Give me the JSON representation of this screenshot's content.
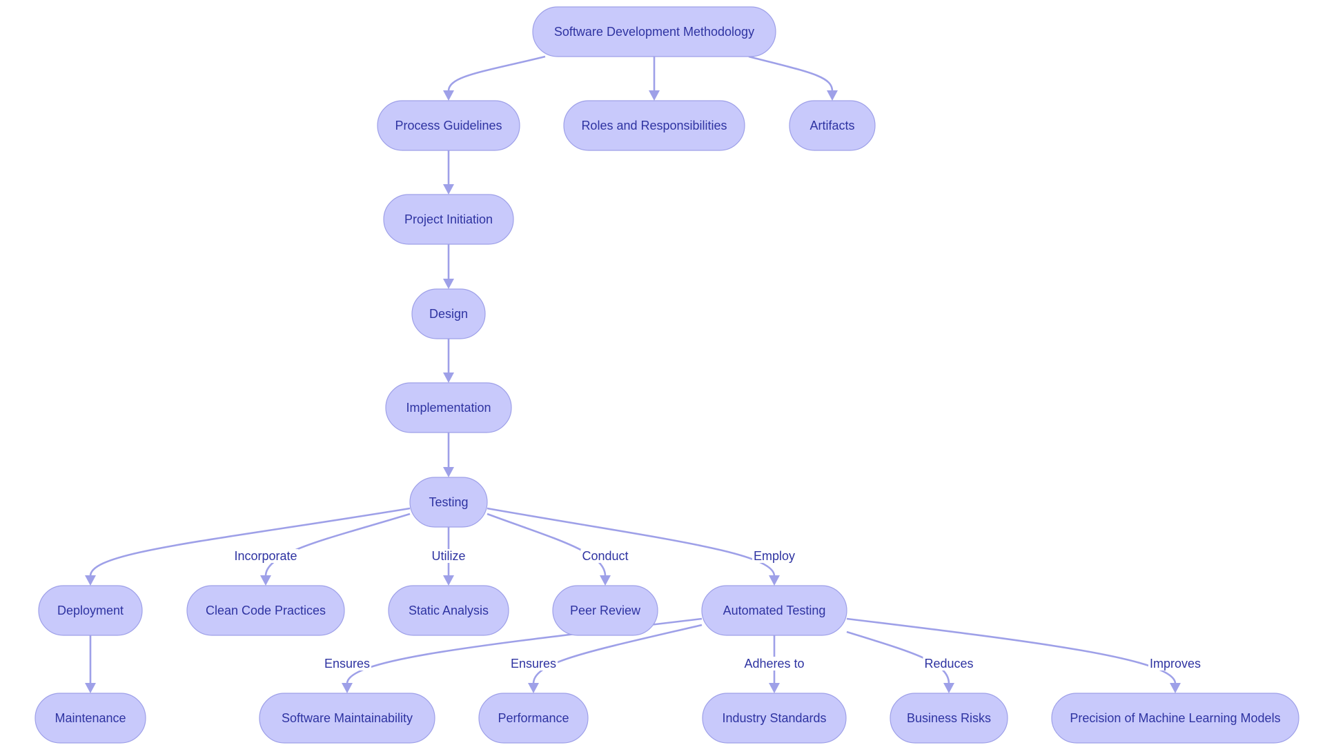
{
  "diagram": {
    "type": "flowchart",
    "title": "Software Development Methodology",
    "colors": {
      "node_fill": "#c8c9fb",
      "node_stroke": "#9ea0e8",
      "edge": "#9ea0e8",
      "text": "#2e33a1"
    },
    "nodes": [
      {
        "id": "sdm",
        "label": "Software Development Methodology"
      },
      {
        "id": "pg",
        "label": "Process Guidelines"
      },
      {
        "id": "rr",
        "label": "Roles and Responsibilities"
      },
      {
        "id": "art",
        "label": "Artifacts"
      },
      {
        "id": "pi",
        "label": "Project Initiation"
      },
      {
        "id": "des",
        "label": "Design"
      },
      {
        "id": "imp",
        "label": "Implementation"
      },
      {
        "id": "tst",
        "label": "Testing"
      },
      {
        "id": "dep",
        "label": "Deployment"
      },
      {
        "id": "ccp",
        "label": "Clean Code Practices"
      },
      {
        "id": "sa",
        "label": "Static Analysis"
      },
      {
        "id": "pr",
        "label": "Peer Review"
      },
      {
        "id": "at",
        "label": "Automated Testing"
      },
      {
        "id": "mnt",
        "label": "Maintenance"
      },
      {
        "id": "sm",
        "label": "Software Maintainability"
      },
      {
        "id": "perf",
        "label": "Performance"
      },
      {
        "id": "is",
        "label": "Industry Standards"
      },
      {
        "id": "br",
        "label": "Business Risks"
      },
      {
        "id": "pml",
        "label": "Precision of Machine Learning Models"
      }
    ],
    "edges": [
      {
        "from": "sdm",
        "to": "pg",
        "label": ""
      },
      {
        "from": "sdm",
        "to": "rr",
        "label": ""
      },
      {
        "from": "sdm",
        "to": "art",
        "label": ""
      },
      {
        "from": "pg",
        "to": "pi",
        "label": ""
      },
      {
        "from": "pi",
        "to": "des",
        "label": ""
      },
      {
        "from": "des",
        "to": "imp",
        "label": ""
      },
      {
        "from": "imp",
        "to": "tst",
        "label": ""
      },
      {
        "from": "tst",
        "to": "dep",
        "label": ""
      },
      {
        "from": "tst",
        "to": "ccp",
        "label": "Incorporate"
      },
      {
        "from": "tst",
        "to": "sa",
        "label": "Utilize"
      },
      {
        "from": "tst",
        "to": "pr",
        "label": "Conduct"
      },
      {
        "from": "tst",
        "to": "at",
        "label": "Employ"
      },
      {
        "from": "dep",
        "to": "mnt",
        "label": ""
      },
      {
        "from": "at",
        "to": "sm",
        "label": "Ensures"
      },
      {
        "from": "at",
        "to": "perf",
        "label": "Ensures"
      },
      {
        "from": "at",
        "to": "is",
        "label": "Adheres to"
      },
      {
        "from": "at",
        "to": "br",
        "label": "Reduces"
      },
      {
        "from": "at",
        "to": "pml",
        "label": "Improves"
      }
    ]
  }
}
